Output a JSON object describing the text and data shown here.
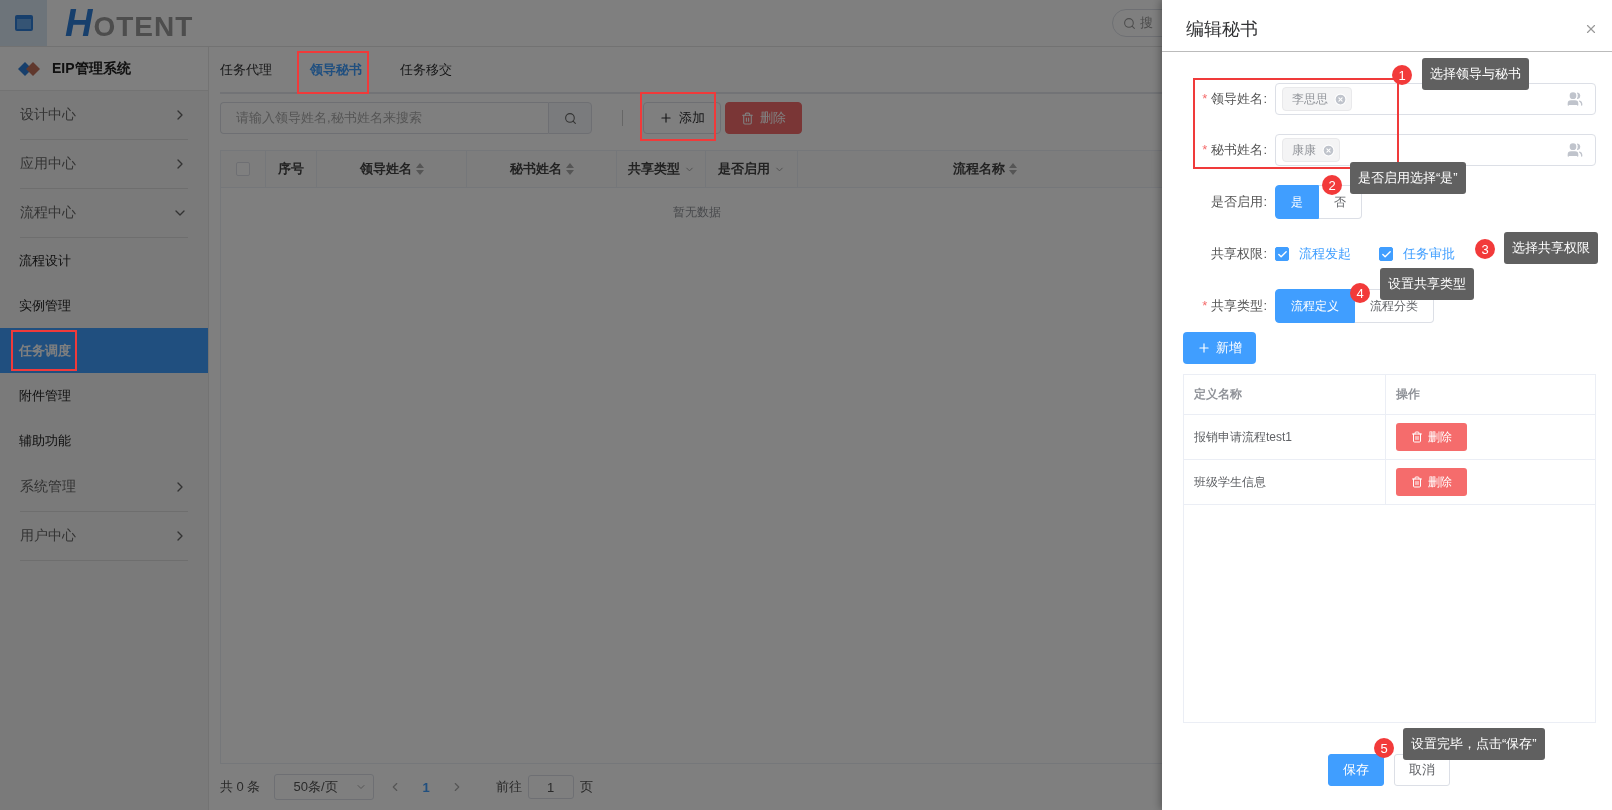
{
  "header": {
    "logo_text": "HOTENT",
    "search_placeholder": "搜"
  },
  "sidebar": {
    "title": "EIP管理系统",
    "items": [
      {
        "label": "设计中心",
        "expanded": false
      },
      {
        "label": "应用中心",
        "expanded": false
      },
      {
        "label": "流程中心",
        "expanded": true,
        "children": [
          {
            "label": "流程设计",
            "selected": false,
            "annotated": false
          },
          {
            "label": "实例管理",
            "selected": false,
            "annotated": false
          },
          {
            "label": "任务调度",
            "selected": true,
            "annotated": true
          },
          {
            "label": "附件管理",
            "selected": false,
            "annotated": false
          },
          {
            "label": "辅助功能",
            "selected": false,
            "annotated": false
          }
        ]
      },
      {
        "label": "系统管理",
        "expanded": false
      },
      {
        "label": "用户中心",
        "expanded": false
      }
    ]
  },
  "tabs": [
    {
      "label": "任务代理",
      "selected": false,
      "annotated": false
    },
    {
      "label": "领导秘书",
      "selected": true,
      "annotated": true
    },
    {
      "label": "任务移交",
      "selected": false,
      "annotated": false
    }
  ],
  "toolbar": {
    "search_placeholder": "请输入领导姓名,秘书姓名来搜索",
    "buttons": [
      {
        "label": "添加",
        "kind": "add",
        "annotated": true
      },
      {
        "label": "删除",
        "kind": "delete",
        "annotated": false
      }
    ]
  },
  "table": {
    "columns": [
      {
        "kind": "checkbox",
        "checked": false
      },
      {
        "label": "序号",
        "kind": "plain"
      },
      {
        "label": "领导姓名",
        "kind": "sort"
      },
      {
        "label": "秘书姓名",
        "kind": "sort"
      },
      {
        "label": "共享类型",
        "kind": "filter"
      },
      {
        "label": "是否启用",
        "kind": "filter"
      },
      {
        "label": "流程名称",
        "kind": "sort"
      }
    ],
    "empty_text": "暂无数据"
  },
  "pagination": {
    "total": "共 0 条",
    "page_size": "50条/页",
    "pages": [
      {
        "label": "1",
        "selected": true
      }
    ],
    "goto_label": "前往",
    "goto_value": "1",
    "goto_suffix": "页"
  },
  "drawer": {
    "title": "编辑秘书",
    "required_mark": "*",
    "fields": [
      {
        "kind": "tags",
        "label": "领导姓名:",
        "required": true,
        "tags": [
          "李思思"
        ]
      },
      {
        "kind": "tags",
        "label": "秘书姓名:",
        "required": true,
        "tags": [
          "康康"
        ]
      },
      {
        "kind": "toggle",
        "label": "是否启用:",
        "required": false,
        "options": [
          {
            "label": "是",
            "selected": true
          },
          {
            "label": "否",
            "selected": false
          }
        ]
      },
      {
        "kind": "checkboxes",
        "label": "共享权限:",
        "required": false,
        "options": [
          {
            "label": "流程发起",
            "checked": true
          },
          {
            "label": "任务审批",
            "checked": true
          }
        ]
      },
      {
        "kind": "toggle",
        "label": "共享类型:",
        "required": true,
        "options": [
          {
            "label": "流程定义",
            "selected": true
          },
          {
            "label": "流程分类",
            "selected": false
          }
        ]
      }
    ],
    "add_button": "新增",
    "table": {
      "columns": [
        "定义名称",
        "操作"
      ],
      "rows": [
        {
          "name": "报销申请流程test1",
          "action": "删除"
        },
        {
          "name": "班级学生信息",
          "action": "删除"
        }
      ]
    },
    "footer_buttons": [
      {
        "label": "保存",
        "kind": "primary"
      },
      {
        "label": "取消",
        "kind": "default"
      }
    ]
  },
  "annotations": [
    {
      "number": "1",
      "text": "选择领导与秘书"
    },
    {
      "number": "2",
      "text": "是否启用选择“是”"
    },
    {
      "number": "3",
      "text": "选择共享权限"
    },
    {
      "number": "4",
      "text": "设置共享类型"
    },
    {
      "number": "5",
      "text": "设置完毕，点击“保存”"
    }
  ]
}
